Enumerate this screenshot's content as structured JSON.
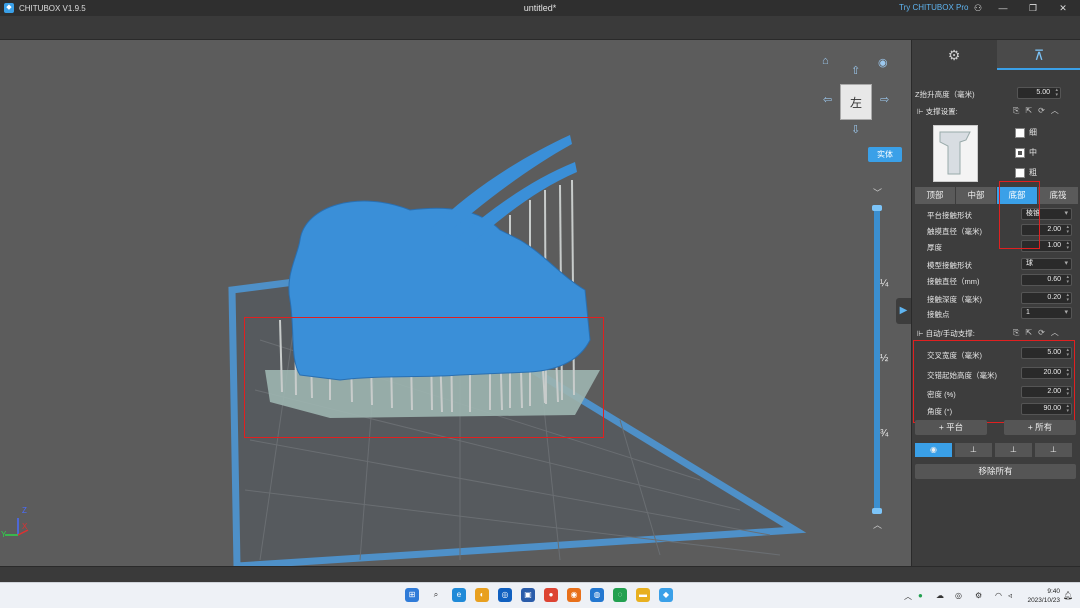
{
  "titlebar": {
    "app_name": "CHITUBOX V1.9.5",
    "document": "untitled*",
    "try_pro": "Try CHITUBOX Pro",
    "icons": [
      "user-icon",
      "minimize-icon",
      "restore-icon",
      "close-icon"
    ]
  },
  "viewport": {
    "view_cube_face": "左",
    "solid_button": "实体",
    "slider_labels": [
      "¼",
      "½",
      "¾"
    ],
    "axis_labels": {
      "z": "Z",
      "y": "Y",
      "x": "X"
    },
    "colors": {
      "model": "#3a8fd8",
      "support": "#c8cccb",
      "plate": "#4e90c8",
      "highlight": "#e02020"
    }
  },
  "panel": {
    "tabs": [
      "model-settings-tab",
      "support-tab"
    ],
    "z_lift": {
      "label": "Z抬升高度（毫米)",
      "value": "5.00"
    },
    "support_settings": {
      "label": "支撑设置:",
      "options": [
        {
          "label": "细",
          "checked": false
        },
        {
          "label": "中",
          "checked": true
        },
        {
          "label": "粗",
          "checked": false
        }
      ]
    },
    "segments": [
      "顶部",
      "中部",
      "底部",
      "底筏"
    ],
    "active_segment": "底部",
    "bottom_params": [
      {
        "label": "平台接触形状",
        "value": "棱锥",
        "type": "select"
      },
      {
        "label": "触摸直径（毫米)",
        "value": "2.00",
        "type": "number"
      },
      {
        "label": "厚度",
        "value": "1.00",
        "type": "number"
      },
      {
        "label": "模型接触形状",
        "value": "球",
        "type": "select"
      },
      {
        "label": "接触直径（mm)",
        "value": "0.60",
        "type": "number"
      },
      {
        "label": "接触深度（毫米)",
        "value": "0.20",
        "type": "number"
      },
      {
        "label": "接触点",
        "value": "1",
        "type": "select"
      }
    ],
    "auto_support": {
      "label": "自动/手动支撑:",
      "params": [
        {
          "label": "交叉宽度（毫米)",
          "value": "5.00"
        },
        {
          "label": "交错起始高度（毫米)",
          "value": "20.00"
        },
        {
          "label": "密度 (%)",
          "value": "2.00"
        },
        {
          "label": "角度 (°)",
          "value": "90.00"
        }
      ]
    },
    "platform_button": "+ 平台",
    "all_button": "+ 所有",
    "remove_all_button": "移除所有"
  },
  "taskbar": {
    "time": "9:40",
    "date": "2023/10/23"
  }
}
